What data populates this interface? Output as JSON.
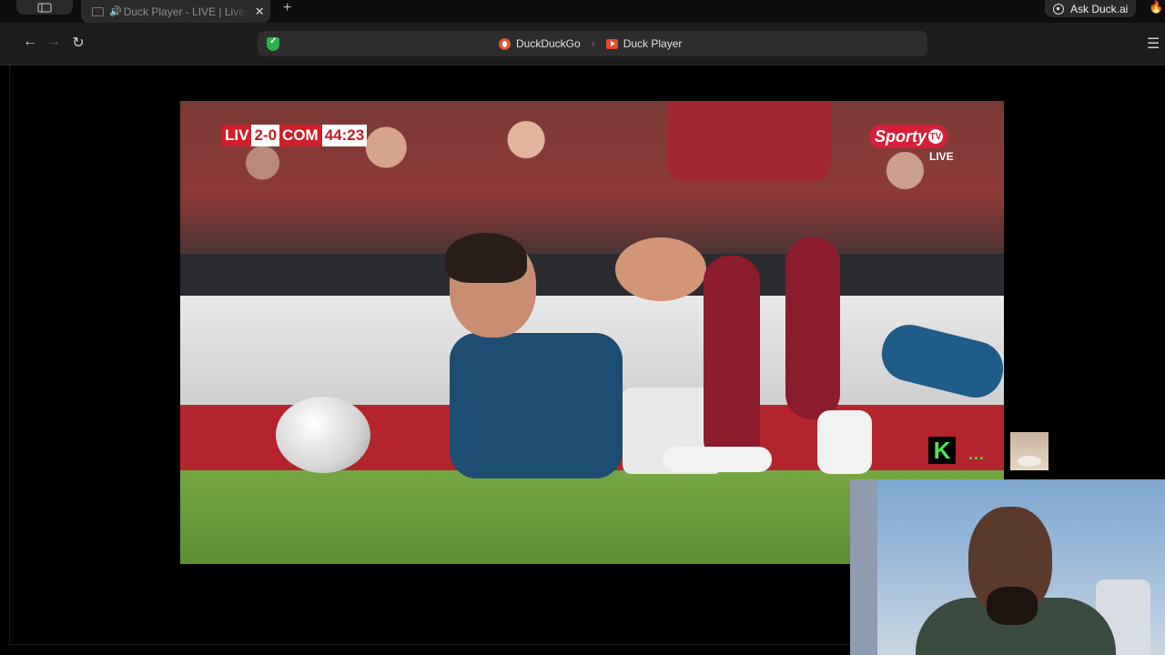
{
  "browser": {
    "tab": {
      "title": "Duck Player - LIVE | Liverpool vs Como",
      "audio_icon": "speaker-icon",
      "close_label": "✕"
    },
    "new_tab_label": "+",
    "ask_duck_label": "Ask Duck.ai",
    "fire_icon": "🔥",
    "nav": {
      "back": "←",
      "forward": "→",
      "reload": "↻",
      "menu": "☰"
    },
    "address": {
      "crumb_1": "DuckDuckGo",
      "separator": "›",
      "crumb_2": "Duck Player"
    },
    "colors": {
      "shield": "#2fb24a",
      "ddg": "#de5833",
      "duck_player": "#e24a2b"
    }
  },
  "video": {
    "scorebug": {
      "home": "LIV",
      "score": "2-0",
      "away": "COM",
      "clock": "44:23"
    },
    "broadcaster": {
      "name": "Sporty",
      "tv_badge": "TV",
      "live": "LIVE"
    },
    "k_logo": "K",
    "more_dots": "..."
  }
}
